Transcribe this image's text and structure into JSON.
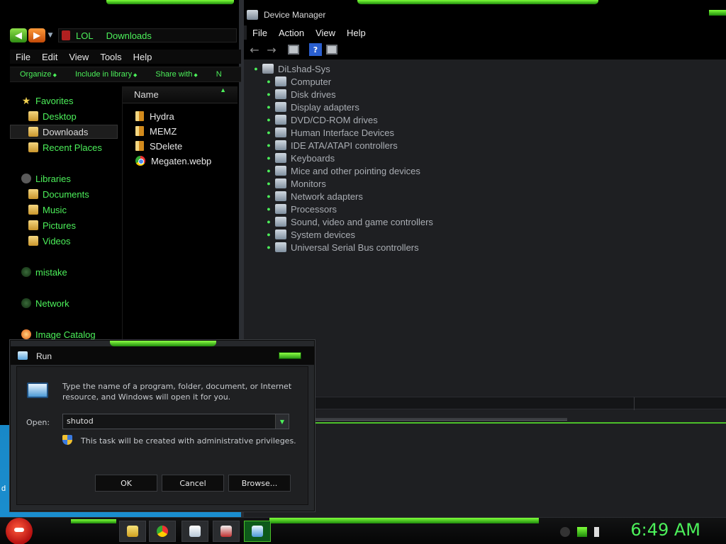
{
  "explorer": {
    "address_crumbs": [
      "LOL",
      "Downloads"
    ],
    "menu": [
      "File",
      "Edit",
      "View",
      "Tools",
      "Help"
    ],
    "commands": [
      "Organize",
      "Include in library",
      "Share with",
      "N"
    ],
    "nav": [
      {
        "label": "Favorites",
        "icon": "star-icon",
        "kind": "star"
      },
      {
        "label": "Desktop",
        "icon": "desktop-icon",
        "kind": "folder"
      },
      {
        "label": "Downloads",
        "icon": "downloads-icon",
        "kind": "folder",
        "selected": true
      },
      {
        "label": "Recent Places",
        "icon": "recent-places-icon",
        "kind": "folder"
      },
      {
        "label": "Libraries",
        "icon": "libraries-icon",
        "kind": "lib"
      },
      {
        "label": "Documents",
        "icon": "documents-icon",
        "kind": "folder"
      },
      {
        "label": "Music",
        "icon": "music-icon",
        "kind": "folder"
      },
      {
        "label": "Pictures",
        "icon": "pictures-icon",
        "kind": "folder"
      },
      {
        "label": "Videos",
        "icon": "videos-icon",
        "kind": "folder"
      },
      {
        "label": "mistake",
        "icon": "homegroup-icon",
        "kind": "globe"
      },
      {
        "label": "Network",
        "icon": "network-icon",
        "kind": "globe"
      },
      {
        "label": "Image Catalog",
        "icon": "image-catalog-icon",
        "kind": "flame"
      }
    ],
    "column_name": "Name",
    "files": [
      {
        "name": "Hydra",
        "kind": "folder"
      },
      {
        "name": "MEMZ",
        "kind": "folder"
      },
      {
        "name": "SDelete",
        "kind": "folder"
      },
      {
        "name": "Megaten.webp",
        "kind": "chrome"
      }
    ]
  },
  "device_manager": {
    "title": "Device Manager",
    "menu": [
      "File",
      "Action",
      "View",
      "Help"
    ],
    "root": "DiLshad-Sys",
    "categories": [
      "Computer",
      "Disk drives",
      "Display adapters",
      "DVD/CD-ROM drives",
      "Human Interface Devices",
      "IDE ATA/ATAPI controllers",
      "Keyboards",
      "Mice and other pointing devices",
      "Monitors",
      "Network adapters",
      "Processors",
      "Sound, video and game controllers",
      "System devices",
      "Universal Serial Bus controllers"
    ]
  },
  "run_dialog": {
    "title": "Run",
    "description": "Type the name of a program, folder, document, or Internet resource, and Windows will open it for you.",
    "open_label": "Open:",
    "open_value": "shutod",
    "admin_note": "This task will be created with administrative privileges.",
    "ok_label": "OK",
    "cancel_label": "Cancel",
    "browse_label": "Browse..."
  },
  "taskbar": {
    "clock": "6:49 AM",
    "pinned": [
      "explorer-icon",
      "chrome-icon",
      "notepad-icon",
      "calculator-icon",
      "run-icon"
    ],
    "tray": [
      "chevron-icon",
      "monitor-icon",
      "volume-icon"
    ],
    "desktop_stub": "d"
  },
  "colors": {
    "accent_green": "#4cf05a",
    "window_bg": "#1e1f22",
    "explorer_bg": "#000000"
  }
}
